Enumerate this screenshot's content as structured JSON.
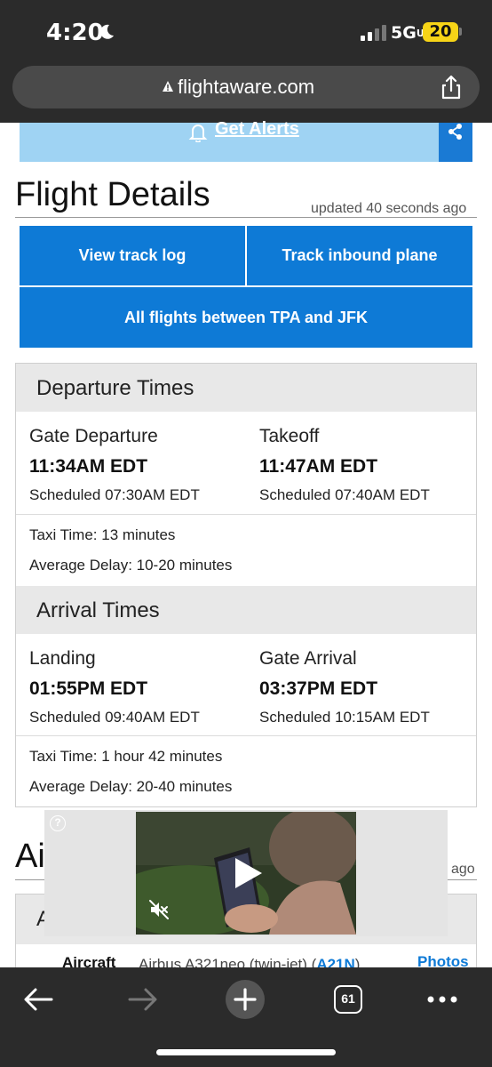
{
  "status_bar": {
    "time": "4:20",
    "network": "5G",
    "network_suffix": "UC",
    "battery": "20"
  },
  "browser": {
    "url": "flightaware.com",
    "tab_count": "61"
  },
  "alerts": {
    "label": "Get Alerts"
  },
  "flight_details": {
    "title": "Flight Details",
    "updated": "updated 40 seconds ago",
    "buttons": {
      "track_log": "View track log",
      "track_inbound": "Track inbound plane",
      "all_flights": "All flights between TPA and JFK"
    }
  },
  "departure": {
    "heading": "Departure Times",
    "gate_departure": {
      "label": "Gate Departure",
      "time": "11:34AM EDT",
      "scheduled": "Scheduled 07:30AM EDT"
    },
    "takeoff": {
      "label": "Takeoff",
      "time": "11:47AM EDT",
      "scheduled": "Scheduled 07:40AM EDT"
    },
    "taxi_time": "Taxi Time: 13 minutes",
    "average_delay": "Average Delay: 10-20 minutes"
  },
  "arrival": {
    "heading": "Arrival Times",
    "landing": {
      "label": "Landing",
      "time": "01:55PM EDT",
      "scheduled": "Scheduled 09:40AM EDT"
    },
    "gate_arrival": {
      "label": "Gate Arrival",
      "time": "03:37PM EDT",
      "scheduled": "Scheduled 10:15AM EDT"
    },
    "taxi_time": "Taxi Time: 1 hour 42 minutes",
    "average_delay": "Average Delay: 20-40 minutes"
  },
  "aircraft_section": {
    "title_visible": "Ai",
    "updated_visible": "ago",
    "card_head_visible": "A",
    "aircraft_label": "Aircraft",
    "aircraft_value": "Airbus A321neo (twin-jet) (",
    "aircraft_code": "A21N",
    "aircraft_close": ")",
    "photos": "Photos"
  },
  "ad": {
    "info_glyph": "?"
  },
  "colors": {
    "accent": "#0e7ad6",
    "alerts_bg": "#9fd3f3",
    "section_bg": "#e8e8e8",
    "chrome_bg": "#2b2b2b",
    "battery": "#f7d417"
  }
}
